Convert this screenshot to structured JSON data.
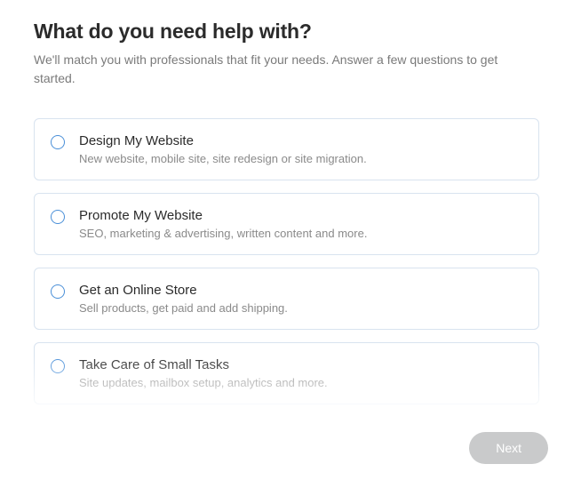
{
  "heading": "What do you need help with?",
  "subheading": "We'll match you with professionals that fit your needs. Answer a few questions to get started.",
  "options": [
    {
      "title": "Design My Website",
      "desc": "New website, mobile site, site redesign or site migration."
    },
    {
      "title": "Promote My Website",
      "desc": "SEO, marketing & advertising, written content and more."
    },
    {
      "title": "Get an Online Store",
      "desc": "Sell products, get paid and add shipping."
    },
    {
      "title": "Take Care of Small Tasks",
      "desc": "Site updates, mailbox setup, analytics and more."
    }
  ],
  "next_label": "Next"
}
